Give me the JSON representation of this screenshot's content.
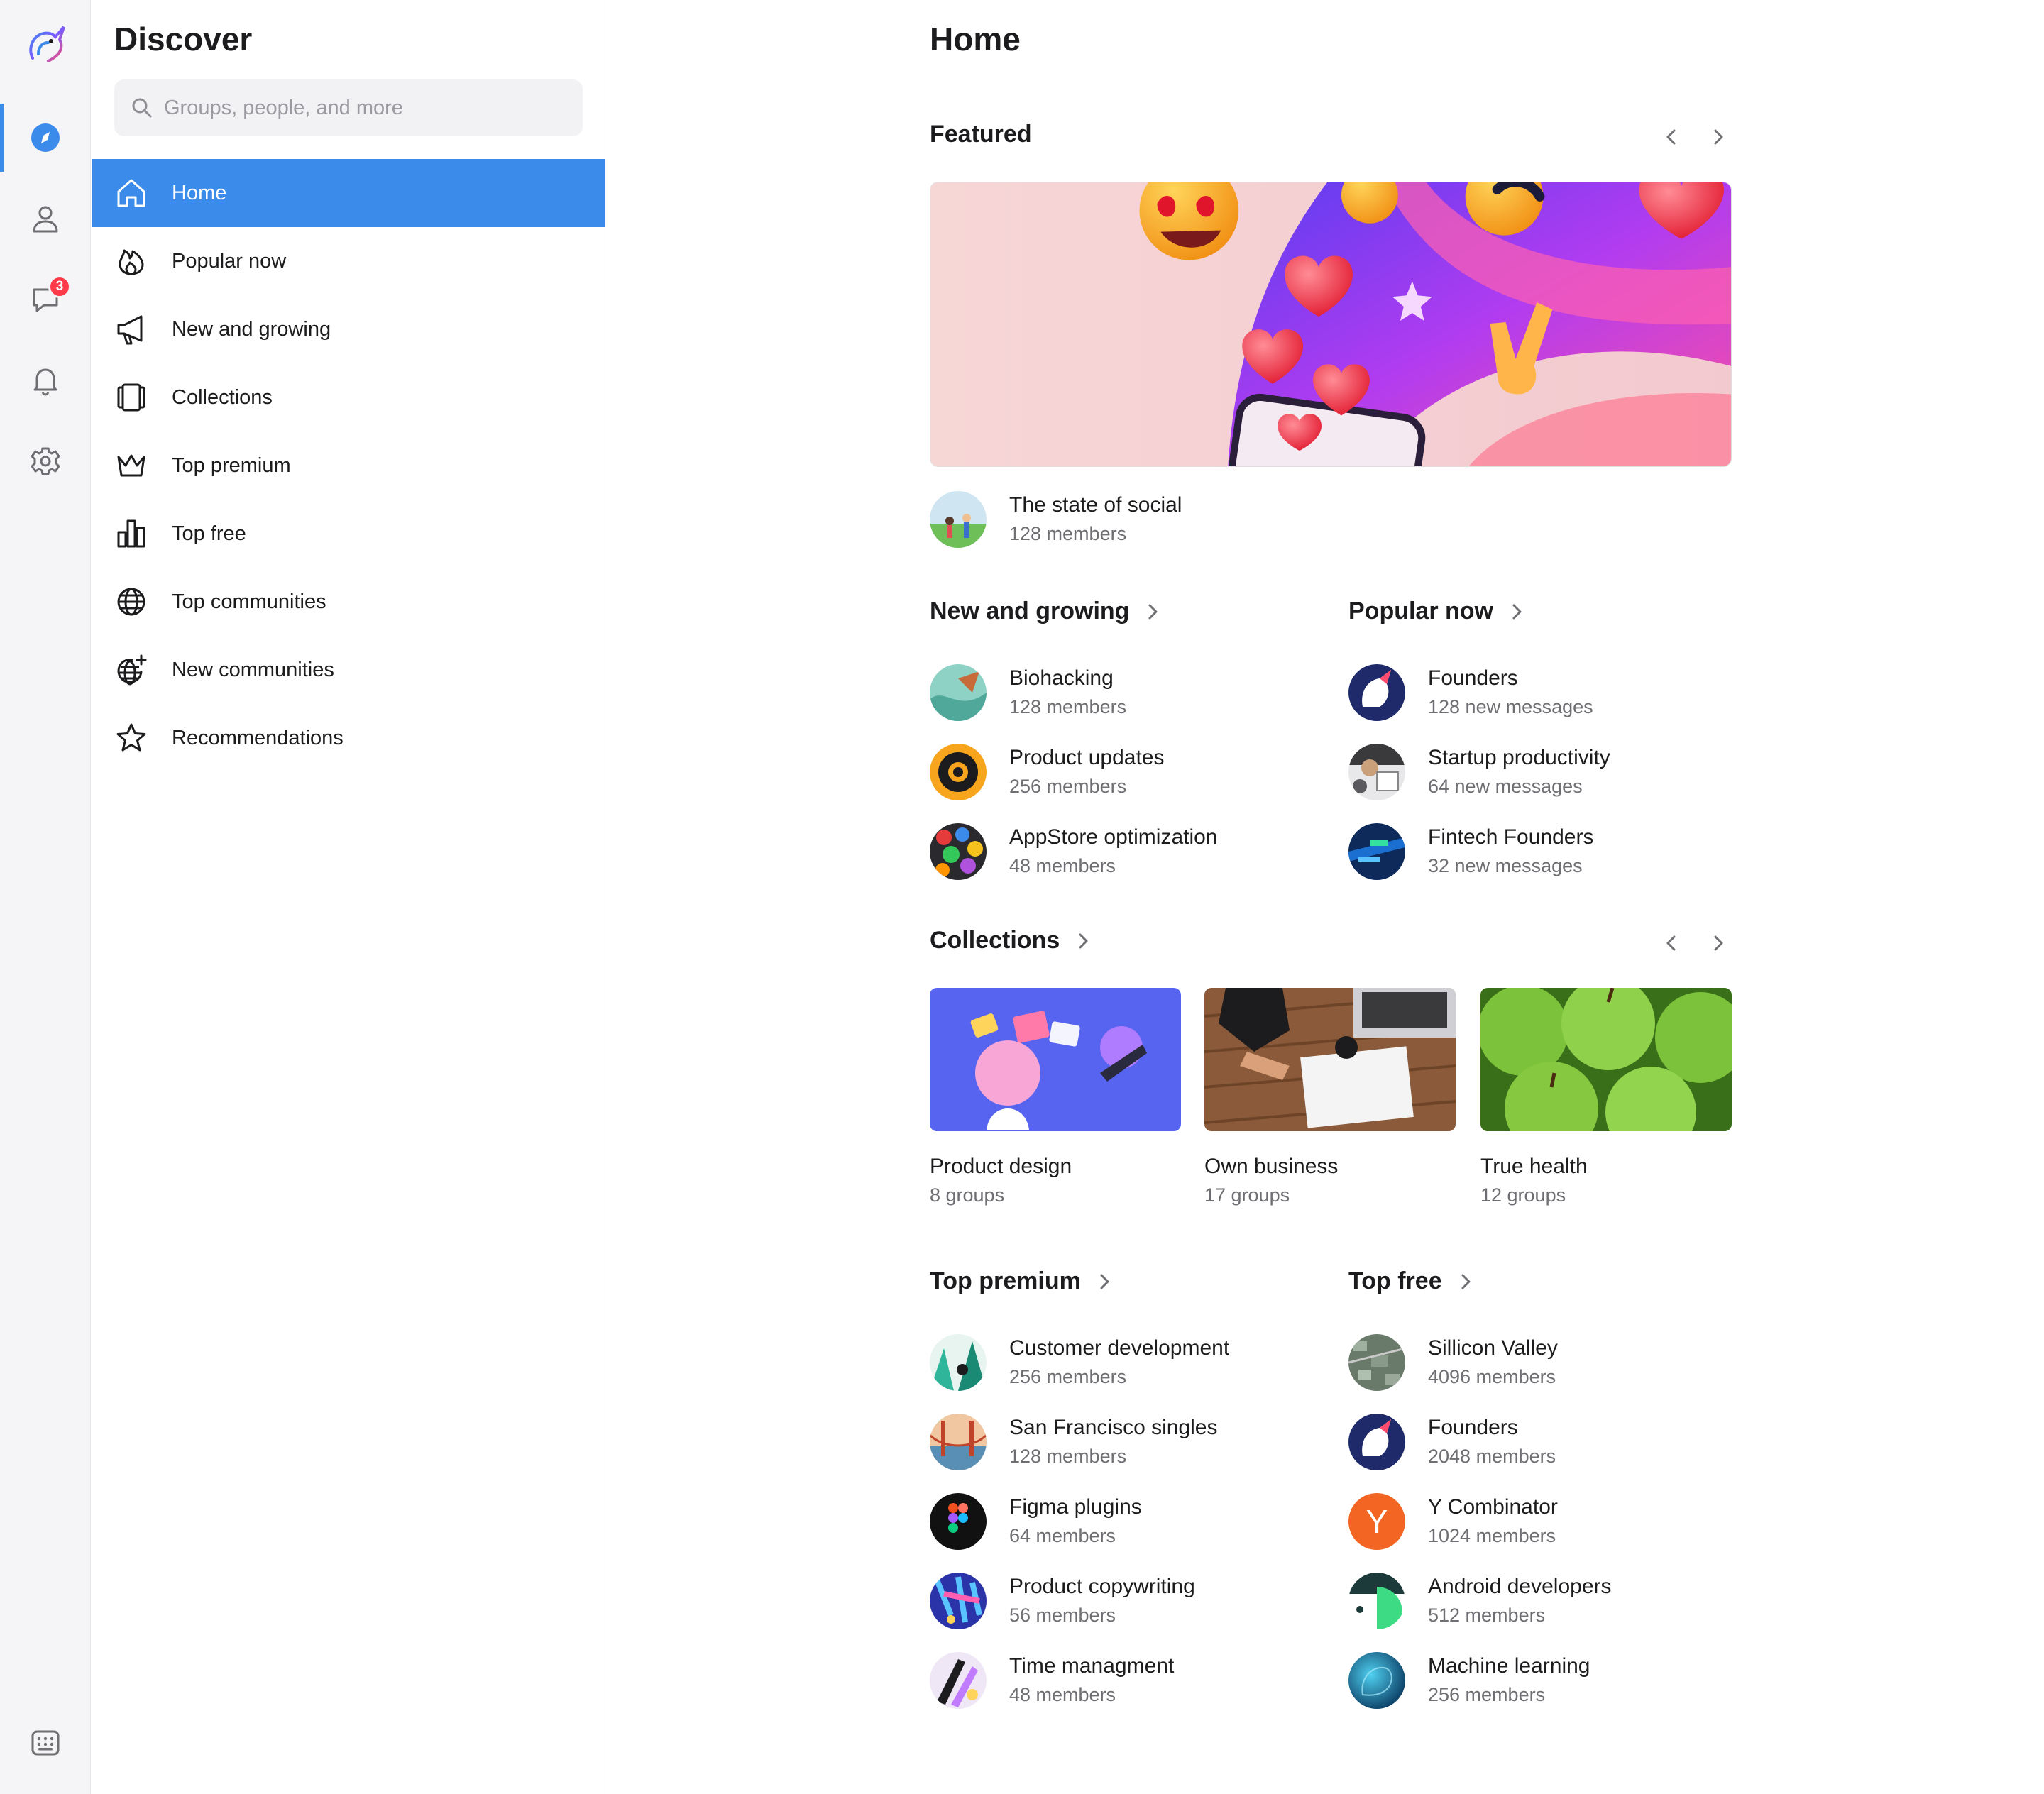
{
  "rail": {
    "chat_badge": "3"
  },
  "sidebar": {
    "title": "Discover",
    "search_placeholder": "Groups, people, and more",
    "items": [
      {
        "label": "Home"
      },
      {
        "label": "Popular now"
      },
      {
        "label": "New and growing"
      },
      {
        "label": "Collections"
      },
      {
        "label": "Top premium"
      },
      {
        "label": "Top free"
      },
      {
        "label": "Top communities"
      },
      {
        "label": "New communities"
      },
      {
        "label": "Recommendations"
      }
    ]
  },
  "main": {
    "title": "Home",
    "featured": {
      "title": "Featured",
      "group_name": "The state of social",
      "group_sub": "128 members"
    },
    "new_growing": {
      "title": "New and growing",
      "items": [
        {
          "name": "Biohacking",
          "sub": "128 members"
        },
        {
          "name": "Product updates",
          "sub": "256 members"
        },
        {
          "name": "AppStore optimization",
          "sub": "48 members"
        }
      ]
    },
    "popular_now": {
      "title": "Popular now",
      "items": [
        {
          "name": "Founders",
          "sub": "128 new messages"
        },
        {
          "name": "Startup productivity",
          "sub": "64 new messages"
        },
        {
          "name": "Fintech Founders",
          "sub": "32 new messages"
        }
      ]
    },
    "collections": {
      "title": "Collections",
      "items": [
        {
          "name": "Product design",
          "sub": "8 groups"
        },
        {
          "name": "Own business",
          "sub": "17 groups"
        },
        {
          "name": "True health",
          "sub": "12 groups"
        }
      ]
    },
    "top_premium": {
      "title": "Top premium",
      "items": [
        {
          "name": "Customer development",
          "sub": "256 members"
        },
        {
          "name": "San Francisco singles",
          "sub": "128 members"
        },
        {
          "name": "Figma plugins",
          "sub": "64 members"
        },
        {
          "name": "Product copywriting",
          "sub": "56 members"
        },
        {
          "name": "Time managment",
          "sub": "48 members"
        }
      ]
    },
    "top_free": {
      "title": "Top free",
      "items": [
        {
          "name": "Sillicon Valley",
          "sub": "4096 members"
        },
        {
          "name": "Founders",
          "sub": "2048 members"
        },
        {
          "name": "Y Combinator",
          "sub": "1024 members"
        },
        {
          "name": "Android developers",
          "sub": "512 members"
        },
        {
          "name": "Machine learning",
          "sub": "256 members"
        }
      ],
      "yc_letter": "Y"
    }
  },
  "colors": {
    "accent": "#3b8beb",
    "badge": "#ff3b4a",
    "muted_text": "#6e6e73"
  }
}
